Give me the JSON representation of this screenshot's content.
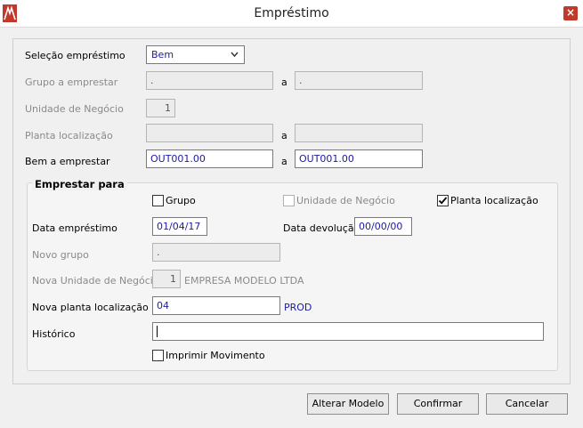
{
  "window": {
    "title": "Empréstimo",
    "close": "×"
  },
  "top": {
    "selecao_label": "Seleção empréstimo",
    "selecao_value": "Bem",
    "grupo_label": "Grupo a emprestar",
    "grupo_from": ".",
    "grupo_to": ".",
    "unidade_label": "Unidade de Negócio",
    "unidade_value": "1",
    "planta_label": "Planta localização",
    "planta_from": "",
    "planta_to": "",
    "bem_label": "Bem a emprestar",
    "bem_from": "OUT001.00",
    "bem_to": "OUT001.00",
    "a_sep": "a"
  },
  "emprestar": {
    "title": "Emprestar para",
    "chk_grupo_label": "Grupo",
    "chk_grupo_checked": false,
    "chk_unidade_label": "Unidade de Negócio",
    "chk_unidade_checked": false,
    "chk_planta_label": "Planta localização",
    "chk_planta_checked": true,
    "data_emprestimo_label": "Data empréstimo",
    "data_emprestimo_value": "01/04/17",
    "data_devolucao_label": "Data devolução",
    "data_devolucao_value": "00/00/00",
    "novo_grupo_label": "Novo grupo",
    "novo_grupo_value": ".",
    "nova_unidade_label": "Nova Unidade de Negócio",
    "nova_unidade_value": "1",
    "nova_unidade_desc": "EMPRESA MODELO LTDA",
    "nova_planta_label": "Nova planta localização",
    "nova_planta_value": "04",
    "nova_planta_desc": "PROD",
    "historico_label": "Histórico",
    "historico_value": "",
    "imprimir_label": "Imprimir Movimento",
    "imprimir_checked": false
  },
  "buttons": {
    "alterar": "Alterar Modelo",
    "confirmar": "Confirmar",
    "cancelar": "Cancelar"
  }
}
